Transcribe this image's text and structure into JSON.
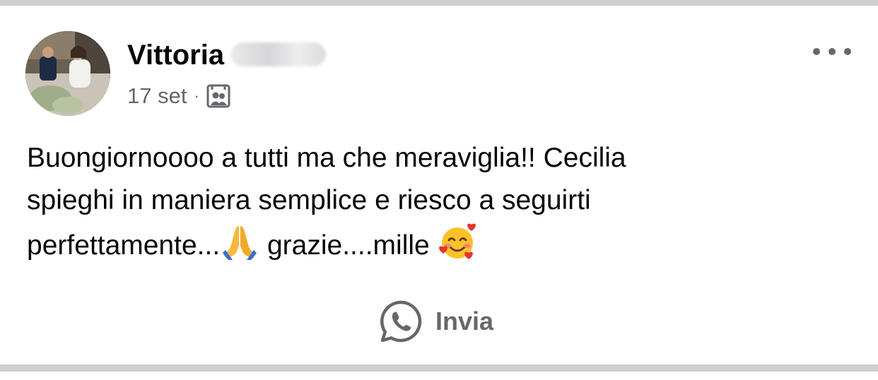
{
  "post": {
    "author_first_name": "Vittoria",
    "timestamp": "17 set",
    "separator": "·",
    "audience_icon": "group-audience-icon",
    "more_icon": "more-options-icon",
    "text_lines": [
      "Buongiornoooo a tutti ma che meraviglia!!  Cecilia",
      "spieghi in maniera semplice e riesco a seguirti",
      "perfettamente...",
      " grazie....mille "
    ],
    "emoji_1": "folded-hands-emoji",
    "emoji_2": "smiling-face-with-hearts-emoji",
    "share": {
      "icon": "whatsapp-icon",
      "label": "Invia"
    }
  },
  "colors": {
    "text_primary": "#050505",
    "text_secondary": "#65676b",
    "separator": "#ced0d4",
    "background": "#ffffff"
  }
}
